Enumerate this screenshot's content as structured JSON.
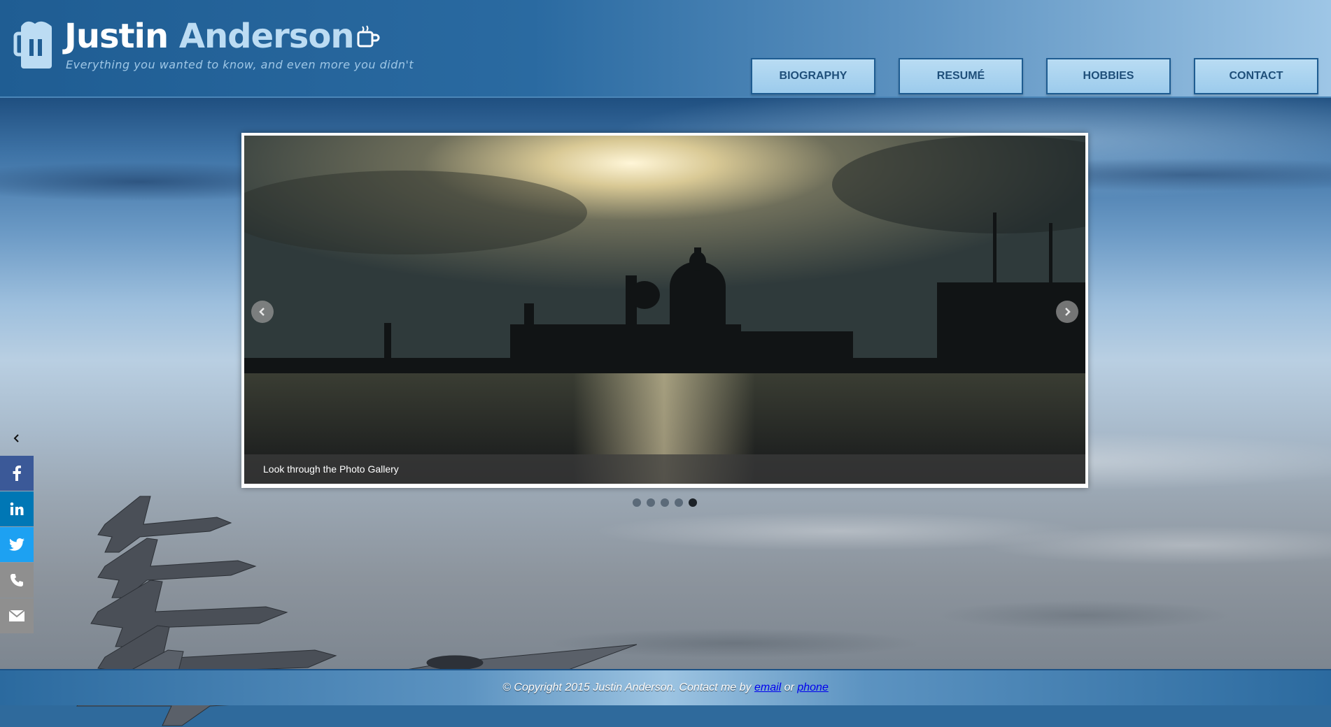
{
  "header": {
    "brand_first": "Justin",
    "brand_last": "Anderson",
    "tagline": "Everything you wanted to know, and even more you didn't"
  },
  "nav": {
    "items": [
      {
        "label": "BIOGRAPHY"
      },
      {
        "label": "RESUMÉ"
      },
      {
        "label": "HOBBIES"
      },
      {
        "label": "CONTACT"
      }
    ]
  },
  "carousel": {
    "caption": "Look through the Photo Gallery",
    "slide_count": 5,
    "active_index": 4,
    "prev_icon": "chevron-left-icon",
    "next_icon": "chevron-right-icon"
  },
  "social": {
    "toggle_icon": "chevron-left-icon",
    "items": [
      {
        "icon": "facebook-icon",
        "color": "#3b5998"
      },
      {
        "icon": "linkedin-icon",
        "color": "#0077b5"
      },
      {
        "icon": "twitter-icon",
        "color": "#1da1f2"
      },
      {
        "icon": "phone-icon",
        "color": "#8f8f8f"
      },
      {
        "icon": "email-icon",
        "color": "#8f8f8f"
      }
    ]
  },
  "footer": {
    "prefix": "© Copyright 2015 Justin Anderson. Contact me by ",
    "email_label": "email",
    "separator": " or ",
    "phone_label": "phone"
  },
  "colors": {
    "header_blue": "#1f5d93",
    "nav_button": "#b9dcf3",
    "nav_text": "#1f4f7a",
    "brand_accent": "#bcdcf3"
  }
}
